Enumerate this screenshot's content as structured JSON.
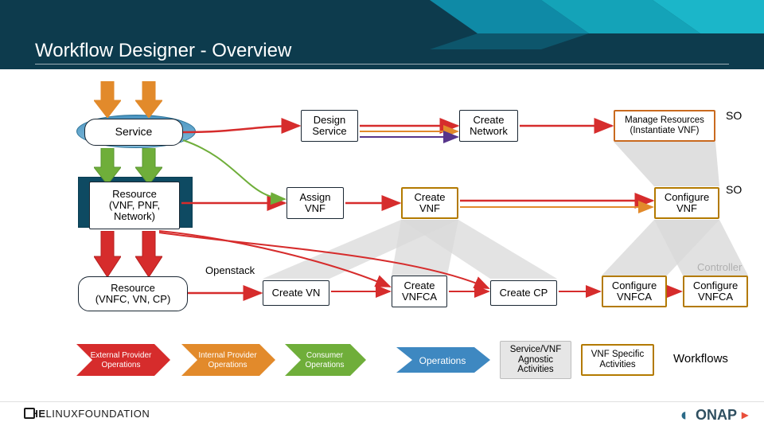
{
  "title": "Workflow Designer - Overview",
  "leftCol": {
    "service": "Service",
    "resource1": "Resource\n(VNF, PNF,\nNetwork)",
    "resource2": "Resource\n(VNFC, VN, CP)"
  },
  "row1": {
    "design": "Design\nService",
    "createNet": "Create\nNetwork",
    "manage": "Manage Resources\n(Instantiate VNF)",
    "so": "SO"
  },
  "row2": {
    "assign": "Assign\nVNF",
    "createVnf": "Create\nVNF",
    "configVnf": "Configure\nVNF",
    "so": "SO"
  },
  "row3": {
    "openstack": "Openstack",
    "createVn": "Create VN",
    "createVnfca": "Create\nVNFCA",
    "createCp": "Create CP",
    "configVnfcaL": "Configure\nVNFCA",
    "configVnfcaR": "Configure\nVNFCA",
    "controller": "Controller"
  },
  "legend": {
    "ext": "External Provider\nOperations",
    "int": "Internal Provider\nOperations",
    "consumer": "Consumer\nOperations",
    "ops": "Operations",
    "svcAgnostic": "Service/VNF\nAgnostic\nActivities",
    "vnfSpecific": "VNF Specific\nActivities",
    "workflows": "Workflows"
  },
  "footer": {
    "linux": "THE LINUX FOUNDATION",
    "onap": "ONAP"
  },
  "colors": {
    "red": "#d62c2c",
    "orange": "#e28a2b",
    "green": "#6fae3a",
    "purple": "#57358b",
    "legendBlue": "#3e88c1",
    "grey": "#cfcfcf"
  }
}
